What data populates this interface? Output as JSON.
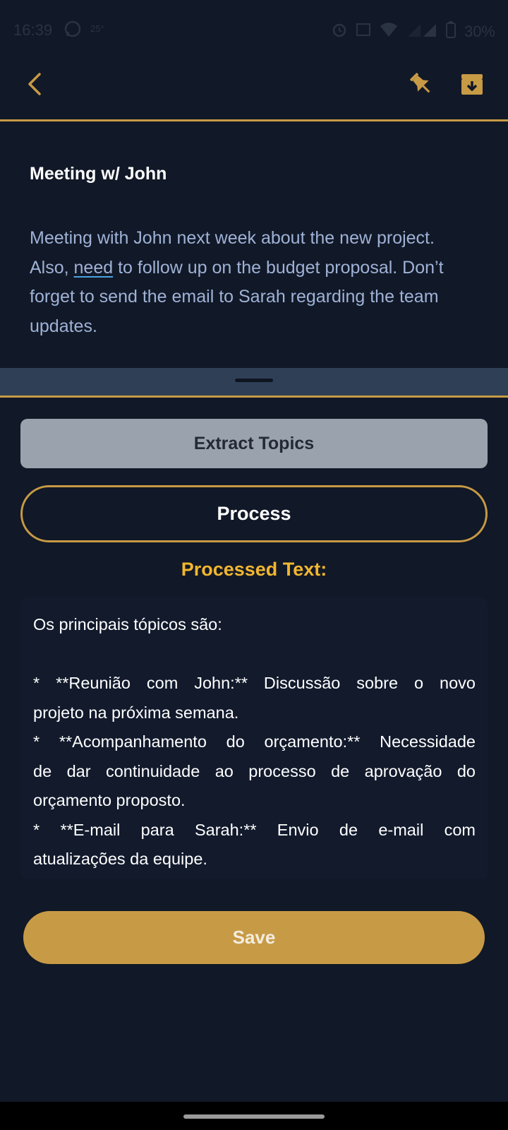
{
  "status_bar": {
    "time": "16:39",
    "temp": "25°",
    "battery": "30%"
  },
  "top_bar": {
    "icons": [
      "back-icon",
      "pin-icon",
      "archive-icon"
    ],
    "accent": "#c79a45"
  },
  "note": {
    "title": "Meeting w/ John",
    "body_part1": "Meeting with John next week about the new project. Also, ",
    "body_misspelled": "need",
    "body_part2": " to follow up on the budget proposal. Don’t forget to send the email to Sarah regarding the team updates."
  },
  "actions": {
    "extract_label": "Extract Topics",
    "process_label": "Process",
    "save_label": "Save"
  },
  "processed": {
    "label": "Processed Text:",
    "lines": [
      "Os principais tópicos são:",
      "",
      "* **Reunião com John:**  Discussão sobre o novo",
      "projeto na próxima semana.",
      "* **Acompanhamento do orçamento:** Necessidade",
      "de dar continuidade ao processo de aprovação do",
      "orçamento proposto.",
      "* **E-mail para Sarah:** Envio de e-mail com",
      "atualizações da equipe."
    ]
  },
  "colors": {
    "background": "#111827",
    "accent": "#c79a45",
    "label_yellow": "#f1b630",
    "body_text": "#9fb2d6"
  }
}
